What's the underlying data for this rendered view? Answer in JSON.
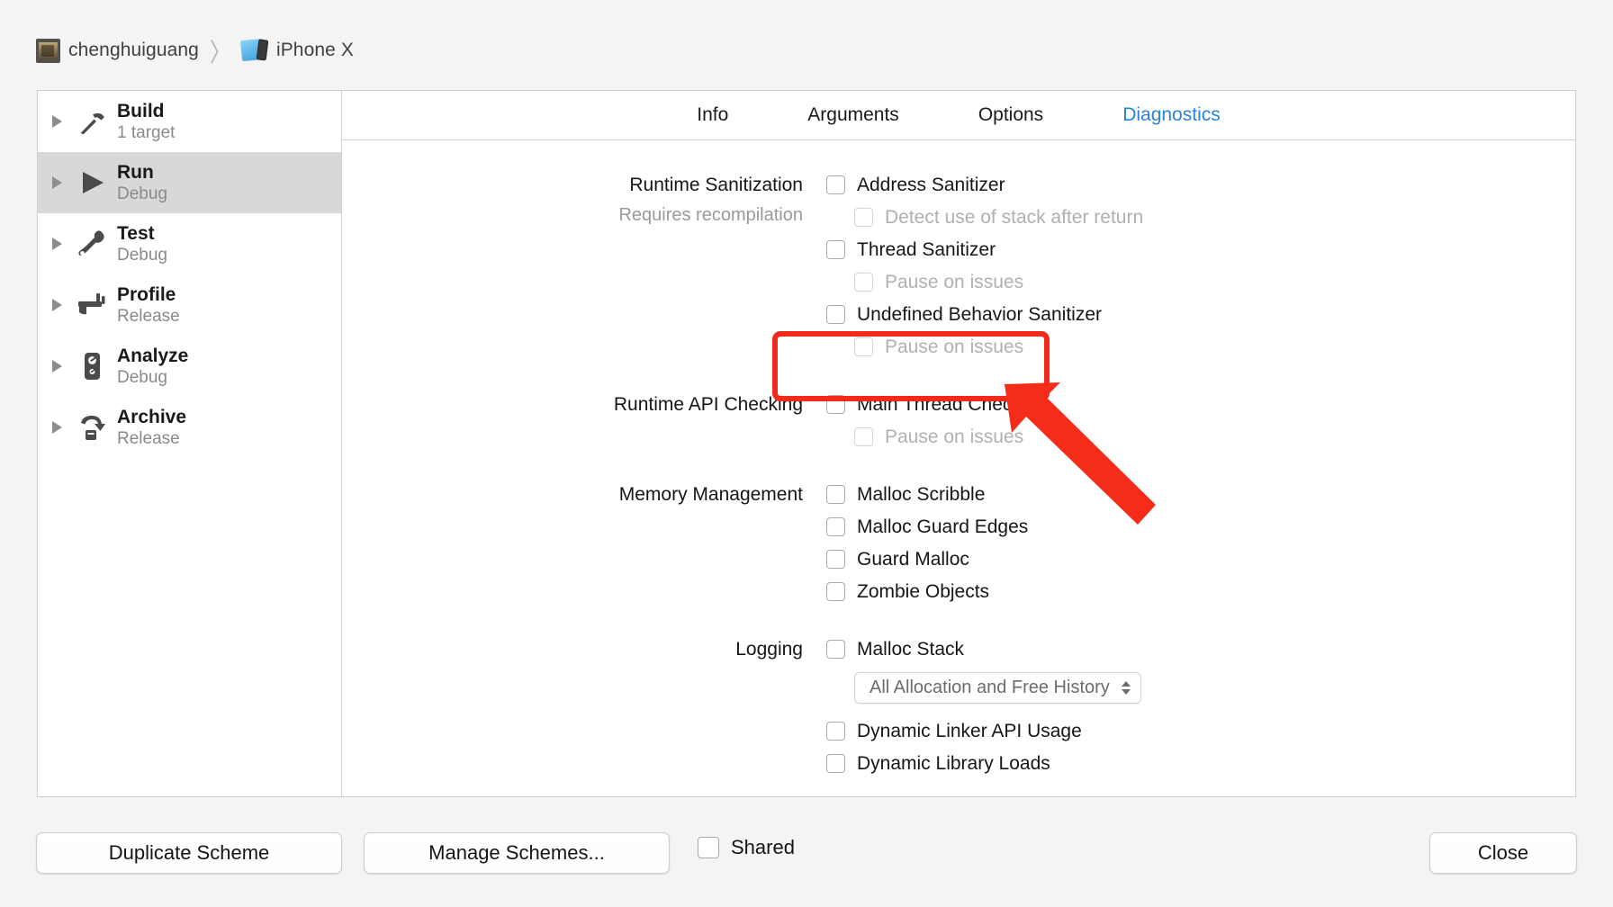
{
  "breadcrumb": {
    "project": "chenghuiguang",
    "separator": "〉",
    "device": "iPhone X",
    "project_icon": "xcode-project-icon",
    "device_icon": "simulator-device-icon"
  },
  "sidebar": {
    "items": [
      {
        "title": "Build",
        "subtitle": "1 target",
        "icon": "hammer-icon",
        "selected": false
      },
      {
        "title": "Run",
        "subtitle": "Debug",
        "icon": "play-icon",
        "selected": true
      },
      {
        "title": "Test",
        "subtitle": "Debug",
        "icon": "wrench-icon",
        "selected": false
      },
      {
        "title": "Profile",
        "subtitle": "Release",
        "icon": "caliper-icon",
        "selected": false
      },
      {
        "title": "Analyze",
        "subtitle": "Debug",
        "icon": "analyze-icon",
        "selected": false
      },
      {
        "title": "Archive",
        "subtitle": "Release",
        "icon": "archive-icon",
        "selected": false
      }
    ]
  },
  "tabs": [
    {
      "label": "Info",
      "active": false
    },
    {
      "label": "Arguments",
      "active": false
    },
    {
      "label": "Options",
      "active": false
    },
    {
      "label": "Diagnostics",
      "active": true
    }
  ],
  "form": {
    "runtime_sanitization": {
      "label": "Runtime Sanitization",
      "sublabel": "Requires recompilation",
      "options": [
        {
          "label": "Address Sanitizer",
          "checked": false,
          "enabled": true,
          "indent": false
        },
        {
          "label": "Detect use of stack after return",
          "checked": false,
          "enabled": false,
          "indent": true
        },
        {
          "label": "Thread Sanitizer",
          "checked": false,
          "enabled": true,
          "indent": false
        },
        {
          "label": "Pause on issues",
          "checked": false,
          "enabled": false,
          "indent": true
        },
        {
          "label": "Undefined Behavior Sanitizer",
          "checked": false,
          "enabled": true,
          "indent": false
        },
        {
          "label": "Pause on issues",
          "checked": false,
          "enabled": false,
          "indent": true
        }
      ]
    },
    "runtime_api_checking": {
      "label": "Runtime API Checking",
      "options": [
        {
          "label": "Main Thread Checker",
          "checked": false,
          "enabled": true,
          "indent": false
        },
        {
          "label": "Pause on issues",
          "checked": false,
          "enabled": false,
          "indent": true
        }
      ]
    },
    "memory_management": {
      "label": "Memory Management",
      "options": [
        {
          "label": "Malloc Scribble",
          "checked": false,
          "enabled": true,
          "indent": false
        },
        {
          "label": "Malloc Guard Edges",
          "checked": false,
          "enabled": true,
          "indent": false
        },
        {
          "label": "Guard Malloc",
          "checked": false,
          "enabled": true,
          "indent": false
        },
        {
          "label": "Zombie Objects",
          "checked": false,
          "enabled": true,
          "indent": false
        }
      ]
    },
    "logging": {
      "label": "Logging",
      "options": [
        {
          "label": "Malloc Stack",
          "checked": false,
          "enabled": true,
          "indent": false
        }
      ],
      "malloc_stack_popup": {
        "selected": "All Allocation and Free History",
        "enabled": false
      },
      "trailing_options": [
        {
          "label": "Dynamic Linker API Usage",
          "checked": false,
          "enabled": true,
          "indent": false
        },
        {
          "label": "Dynamic Library Loads",
          "checked": false,
          "enabled": true,
          "indent": false
        }
      ]
    }
  },
  "annotation": {
    "box_color": "#f22a1b",
    "arrow_color": "#f42c19",
    "target": "Main Thread Checker"
  },
  "footer": {
    "duplicate_scheme": "Duplicate Scheme",
    "manage_schemes": "Manage Schemes...",
    "shared_label": "Shared",
    "shared_checked": false,
    "close": "Close"
  },
  "colors": {
    "accent": "#2b82de",
    "selection": "#d8d8d8",
    "page_bg": "#f4f4f4",
    "panel_bg": "#ffffff",
    "border": "#cfcfcf"
  }
}
